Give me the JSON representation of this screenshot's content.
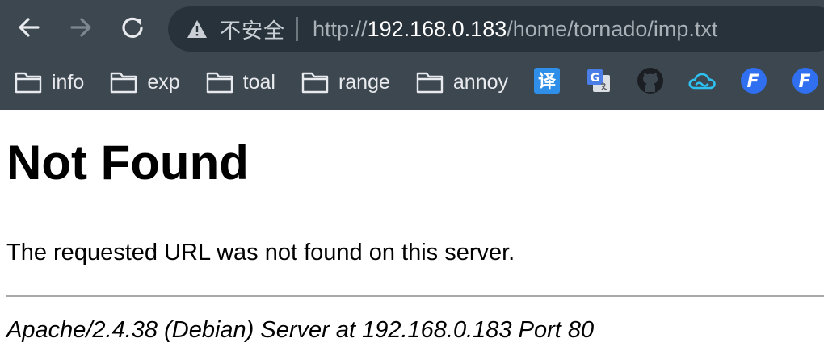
{
  "browser": {
    "back_icon": "arrow-left-icon",
    "forward_icon": "arrow-right-icon",
    "reload_icon": "reload-icon",
    "security_icon": "warning-triangle-icon",
    "security_label": "不安全",
    "url": {
      "scheme": "http://",
      "host": "192.168.0.183",
      "path": "/home/tornado/imp.txt"
    }
  },
  "bookmarks": {
    "folders": [
      {
        "label": "info"
      },
      {
        "label": "exp"
      },
      {
        "label": "toal"
      },
      {
        "label": "range"
      },
      {
        "label": "annoy"
      }
    ],
    "icons": [
      {
        "icon": "translate-icon",
        "glyph": "译",
        "color": "#2f8fe8"
      },
      {
        "icon": "google-translate-icon",
        "glyph": "G",
        "color": "#4a7ee6"
      },
      {
        "icon": "github-icon",
        "color": "#1b1f23"
      },
      {
        "icon": "cloud-icon",
        "color": "#2ec0f0"
      },
      {
        "icon": "f-app-icon",
        "glyph": "F",
        "color": "#2f6ff0"
      },
      {
        "icon": "f-app-icon",
        "glyph": "F",
        "color": "#2f6ff0"
      }
    ]
  },
  "page": {
    "heading": "Not Found",
    "message": "The requested URL was not found on this server.",
    "footer": "Apache/2.4.38 (Debian) Server at 192.168.0.183 Port 80"
  },
  "colors": {
    "toolbar_bg": "#3c4750",
    "omnibox_bg": "#28323a",
    "text_light": "#e8eaed"
  }
}
